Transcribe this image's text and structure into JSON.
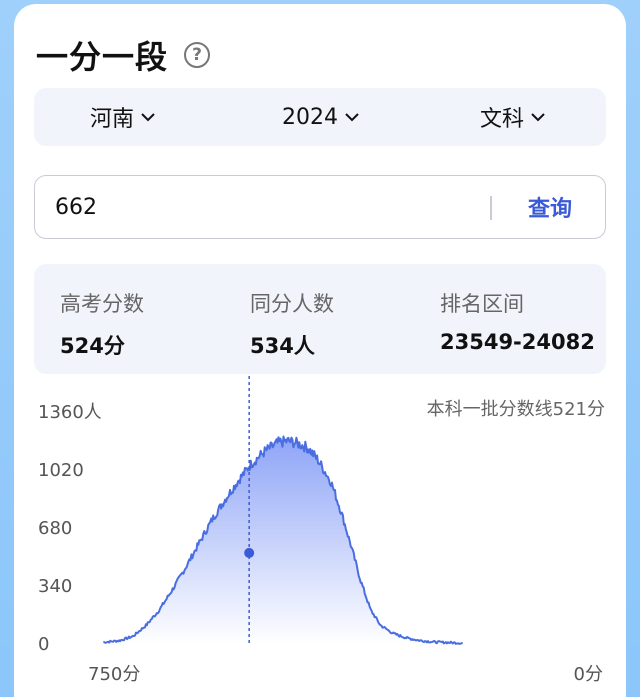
{
  "header": {
    "title": "一分一段",
    "help_icon": "question-circle-icon"
  },
  "selectors": [
    {
      "label": "河南"
    },
    {
      "label": "2024"
    },
    {
      "label": "文科"
    }
  ],
  "search": {
    "value": "662",
    "button_label": "查询"
  },
  "stats": [
    {
      "label": "高考分数",
      "value": "524分"
    },
    {
      "label": "同分人数",
      "value": "534人"
    },
    {
      "label": "排名区间",
      "value": "23549-24082"
    }
  ],
  "colors": {
    "accent": "#3b5bd6",
    "line": "#4a6ee0",
    "fill_top": "#8ea4f7",
    "background": "#9fd0fb"
  },
  "chart_data": {
    "type": "area",
    "x_start_label": "750分",
    "x_end_label": "0分",
    "y_tick_labels": [
      "1360人",
      "1020",
      "680",
      "340",
      "0"
    ],
    "y_ticks": [
      1360,
      1020,
      680,
      340,
      0
    ],
    "ylim": [
      0,
      1360
    ],
    "xlim": [
      750,
      0
    ],
    "annotation": "本科一批分数线521分",
    "marker": {
      "score": 524,
      "count": 534
    },
    "points": [
      [
        745,
        10
      ],
      [
        720,
        20
      ],
      [
        700,
        45
      ],
      [
        680,
        110
      ],
      [
        660,
        200
      ],
      [
        640,
        320
      ],
      [
        620,
        450
      ],
      [
        600,
        590
      ],
      [
        580,
        730
      ],
      [
        560,
        850
      ],
      [
        540,
        960
      ],
      [
        520,
        1060
      ],
      [
        500,
        1130
      ],
      [
        480,
        1180
      ],
      [
        465,
        1190
      ],
      [
        450,
        1175
      ],
      [
        435,
        1150
      ],
      [
        420,
        1080
      ],
      [
        400,
        950
      ],
      [
        385,
        780
      ],
      [
        370,
        580
      ],
      [
        355,
        370
      ],
      [
        340,
        200
      ],
      [
        325,
        110
      ],
      [
        305,
        60
      ],
      [
        285,
        35
      ],
      [
        265,
        20
      ],
      [
        245,
        12
      ],
      [
        200,
        5
      ]
    ]
  }
}
